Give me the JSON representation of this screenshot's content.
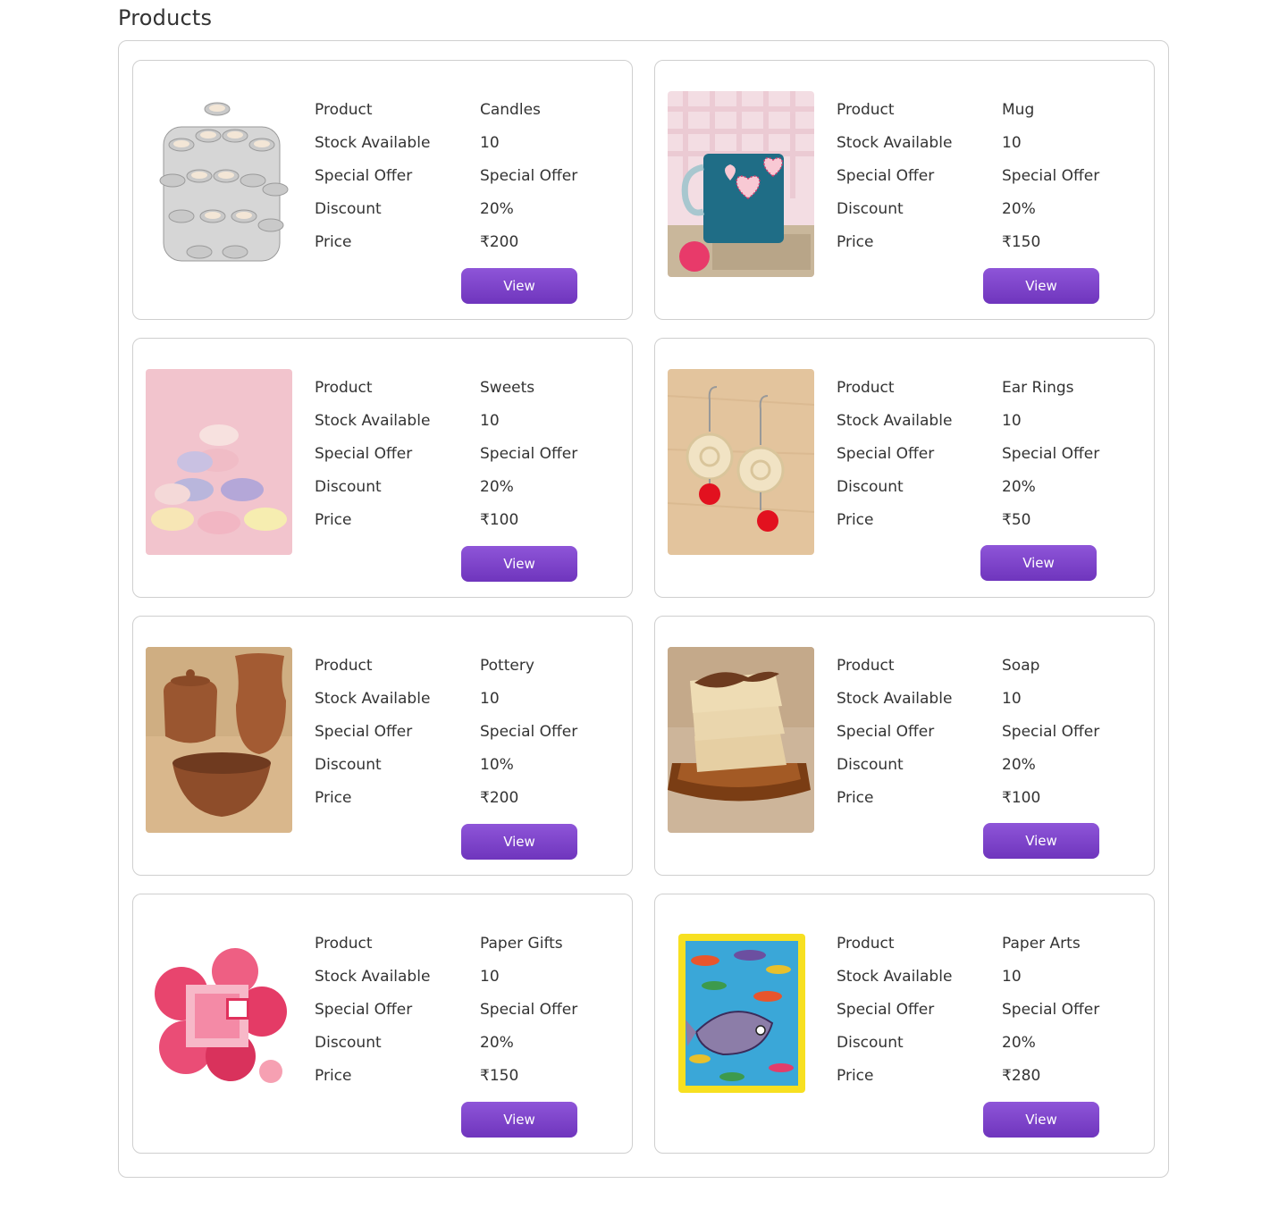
{
  "page": {
    "title": "Products"
  },
  "labels": {
    "product": "Product",
    "stock": "Stock Available",
    "offer": "Special Offer",
    "discount": "Discount",
    "price": "Price",
    "view": "View"
  },
  "colors": {
    "accent": "#7b42c9",
    "border": "#cfcfcf",
    "text": "#333333"
  },
  "products": [
    {
      "name": "Candles",
      "stock": "10",
      "offer": "Special Offer",
      "discount": "20%",
      "price": "₹200"
    },
    {
      "name": "Mug",
      "stock": "10",
      "offer": "Special Offer",
      "discount": "20%",
      "price": "₹150"
    },
    {
      "name": "Sweets",
      "stock": "10",
      "offer": "Special Offer",
      "discount": "20%",
      "price": "₹100"
    },
    {
      "name": "Ear Rings",
      "stock": "10",
      "offer": "Special Offer",
      "discount": "20%",
      "price": "₹50"
    },
    {
      "name": "Pottery",
      "stock": "10",
      "offer": "Special Offer",
      "discount": "10%",
      "price": "₹200"
    },
    {
      "name": "Soap",
      "stock": "10",
      "offer": "Special Offer",
      "discount": "20%",
      "price": "₹100"
    },
    {
      "name": "Paper Gifts",
      "stock": "10",
      "offer": "Special Offer",
      "discount": "20%",
      "price": "₹150"
    },
    {
      "name": "Paper Arts",
      "stock": "10",
      "offer": "Special Offer",
      "discount": "20%",
      "price": "₹280"
    }
  ]
}
